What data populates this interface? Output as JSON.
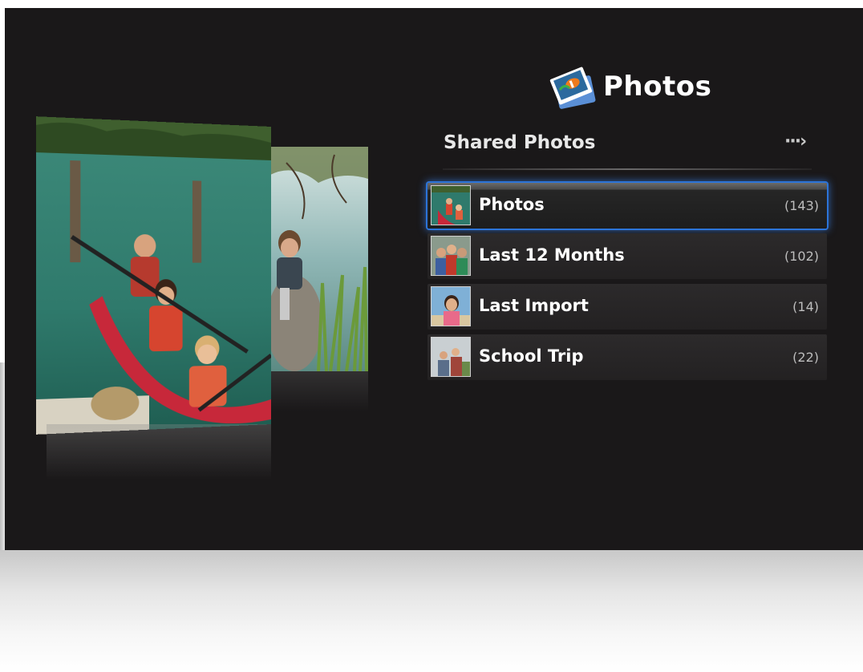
{
  "app": {
    "title": "Photos",
    "icon": "photos-app-icon"
  },
  "section": {
    "heading": "Shared Photos",
    "more_icon": "more-arrow-icon"
  },
  "albums": [
    {
      "label": "Photos",
      "count": "(143)",
      "selected": true,
      "thumb": "kayak-thumbnail"
    },
    {
      "label": "Last 12 Months",
      "count": "(102)",
      "selected": false,
      "thumb": "group-thumbnail"
    },
    {
      "label": "Last Import",
      "count": "(14)",
      "selected": false,
      "thumb": "girl-thumbnail"
    },
    {
      "label": "School Trip",
      "count": "(22)",
      "selected": false,
      "thumb": "trip-thumbnail"
    }
  ],
  "colors": {
    "background": "#1a1819",
    "selection_glow": "#2c74d8",
    "text": "#ffffff",
    "count_text": "#bdbdbd"
  }
}
